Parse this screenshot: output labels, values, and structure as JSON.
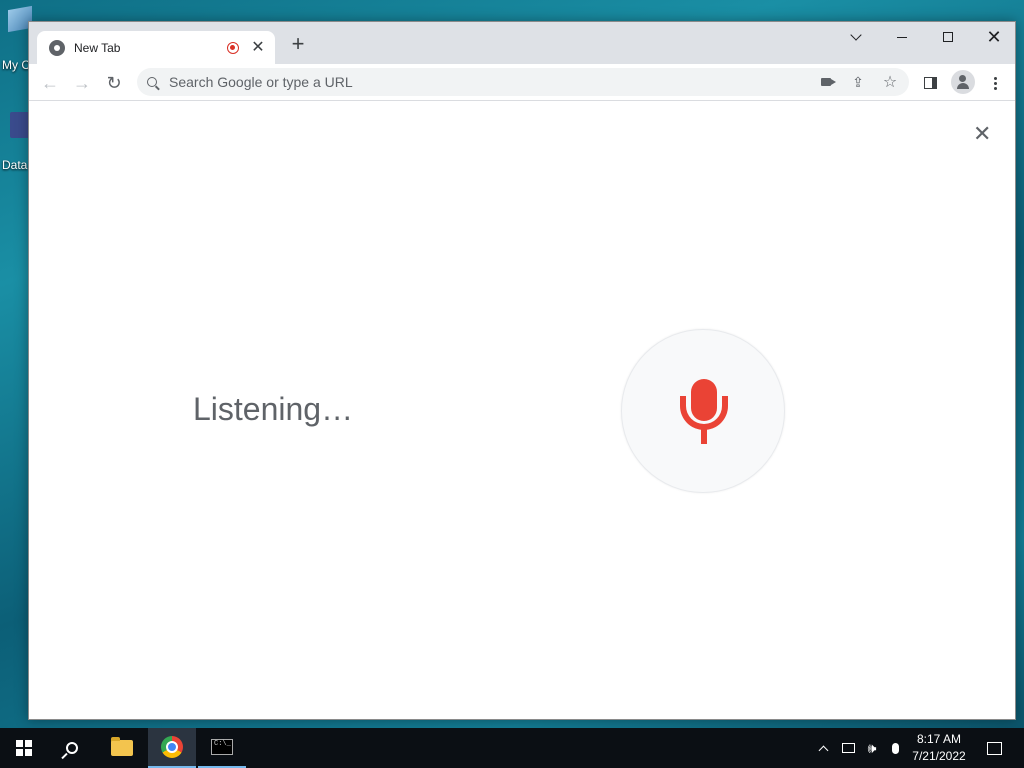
{
  "desktop": {
    "icons": [
      {
        "label": "My C"
      },
      {
        "label": "Data"
      }
    ]
  },
  "browser": {
    "tab": {
      "title": "New Tab",
      "close_glyph": "✕"
    },
    "new_tab_glyph": "+",
    "window_controls": {
      "close_glyph": "✕"
    },
    "toolbar": {
      "back_glyph": "←",
      "forward_glyph": "→",
      "reload_glyph": "↻"
    },
    "omnibox": {
      "placeholder": "Search Google or type a URL",
      "value": ""
    },
    "icons": {
      "share_glyph": "⇪",
      "star_glyph": "☆"
    }
  },
  "voice_search": {
    "status_text": "Listening…",
    "close_glyph": "✕",
    "mic_color": "#ea4335"
  },
  "taskbar": {
    "clock_time": "8:17 AM",
    "clock_date": "7/21/2022",
    "volume_glyph": "🕪",
    "terminal_text": "C:\\_"
  }
}
